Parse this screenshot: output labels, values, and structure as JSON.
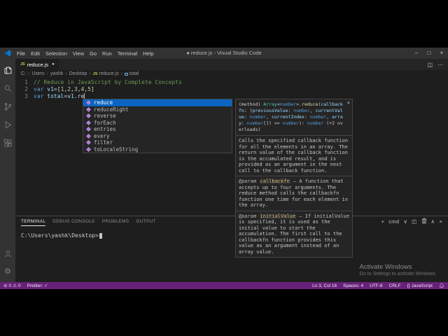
{
  "colors": {
    "statusbar_background": "#68217a",
    "suggest_selection_background": "#0a65c2",
    "editor_background": "#1e1e1e",
    "activitybar_background": "#333333",
    "panel_background": "#252526",
    "comment_green": "#6a9955",
    "keyword_blue": "#569cd6",
    "variable_blue": "#9cdcfe",
    "number_green": "#b5cea8"
  },
  "icons": {
    "js_badge": "JS",
    "minimize": "–",
    "maximize": "□",
    "close": "×",
    "ellipsis": "⋯",
    "split_editor": "◫",
    "dirty_dot": "●",
    "chevron_down": "∨",
    "chevron_up": "∧",
    "plus": "+",
    "error": "⊘",
    "warning": "⚠"
  },
  "titlebar": {
    "menus": [
      "File",
      "Edit",
      "Selection",
      "View",
      "Go",
      "Run",
      "Terminal",
      "Help"
    ],
    "title": "● reduce.js - Visual Studio Code"
  },
  "activitybar": {
    "top": [
      "explorer",
      "search",
      "source-control",
      "run-and-debug",
      "extensions"
    ],
    "bottom": [
      "account",
      "settings"
    ]
  },
  "tabbar": {
    "tab": {
      "label": "reduce.js"
    }
  },
  "breadcrumb": {
    "separator": "›",
    "items": [
      {
        "label": "C:"
      },
      {
        "label": "Users"
      },
      {
        "label": "yashk"
      },
      {
        "label": "Desktop"
      },
      {
        "label": "reduce.js",
        "icon": "js-badge"
      },
      {
        "label": "total",
        "icon": "symbol"
      }
    ]
  },
  "editor": {
    "cursor_line": "3",
    "lines": [
      {
        "num": "1",
        "segments": [
          {
            "t": "// Reduce in JavaScript by Complete Concepts",
            "c": "comment"
          }
        ]
      },
      {
        "num": "2",
        "segments": [
          {
            "t": "var ",
            "c": "keyword"
          },
          {
            "t": "v1",
            "c": "variable"
          },
          {
            "t": "=",
            "c": "plain"
          },
          {
            "t": "[",
            "c": "plain"
          },
          {
            "t": "1",
            "c": "number"
          },
          {
            "t": ",",
            "c": "plain"
          },
          {
            "t": "2",
            "c": "number"
          },
          {
            "t": ",",
            "c": "plain"
          },
          {
            "t": "3",
            "c": "number"
          },
          {
            "t": ",",
            "c": "plain"
          },
          {
            "t": "4",
            "c": "number"
          },
          {
            "t": ",",
            "c": "plain"
          },
          {
            "t": "5",
            "c": "number"
          },
          {
            "t": "]",
            "c": "plain"
          }
        ]
      },
      {
        "num": "3",
        "segments": [
          {
            "t": "var ",
            "c": "keyword"
          },
          {
            "t": "total",
            "c": "variable"
          },
          {
            "t": "=",
            "c": "plain"
          },
          {
            "t": "v1",
            "c": "variable"
          },
          {
            "t": ".re",
            "c": "plain"
          }
        ]
      }
    ]
  },
  "suggest": {
    "items": [
      {
        "label": "reduce",
        "selected": true
      },
      {
        "label": "reduceRight"
      },
      {
        "label": "reverse"
      },
      {
        "label": "forEach"
      },
      {
        "label": "entries"
      },
      {
        "label": "every"
      },
      {
        "label": "filter"
      },
      {
        "label": "toLocaleString"
      }
    ]
  },
  "docs": {
    "signature_segments": [
      {
        "t": "(method) ",
        "c": "plain"
      },
      {
        "t": "Array",
        "c": "type"
      },
      {
        "t": "<",
        "c": "plain"
      },
      {
        "t": "number",
        "c": "kw"
      },
      {
        "t": ">.",
        "c": "plain"
      },
      {
        "t": "reduce",
        "c": "fn"
      },
      {
        "t": "(",
        "c": "plain"
      },
      {
        "t": "callbackfn",
        "c": "param"
      },
      {
        "t": ": (",
        "c": "plain"
      },
      {
        "t": "previousValue",
        "c": "param"
      },
      {
        "t": ": ",
        "c": "plain"
      },
      {
        "t": "number",
        "c": "kw"
      },
      {
        "t": ", ",
        "c": "plain"
      },
      {
        "t": "currentValue",
        "c": "param"
      },
      {
        "t": ": ",
        "c": "plain"
      },
      {
        "t": "number",
        "c": "kw"
      },
      {
        "t": ", ",
        "c": "plain"
      },
      {
        "t": "currentIndex",
        "c": "param"
      },
      {
        "t": ": ",
        "c": "plain"
      },
      {
        "t": "number",
        "c": "kw"
      },
      {
        "t": ", ",
        "c": "plain"
      },
      {
        "t": "array",
        "c": "param"
      },
      {
        "t": ": ",
        "c": "plain"
      },
      {
        "t": "number",
        "c": "kw"
      },
      {
        "t": "[]) => ",
        "c": "plain"
      },
      {
        "t": "number",
        "c": "kw"
      },
      {
        "t": "): ",
        "c": "plain"
      },
      {
        "t": "number",
        "c": "kw"
      },
      {
        "t": " (+2 overloads)",
        "c": "plain"
      }
    ],
    "description": "Calls the specified callback function for all the elements in an array. The return value of the callback function is the accumulated result, and is provided as an argument in the next call to the callback function.",
    "params": [
      {
        "tag": "@param",
        "name": "callbackfn",
        "text": "— A function that accepts up to four arguments. The reduce method calls the callbackfn function one time for each element in the array."
      },
      {
        "tag": "@param",
        "name": "initialValue",
        "text": "— If initialValue is specified, it is used as the initial value to start the accumulation. The first call to the callbackfn function provides this value as an argument instead of an array value."
      }
    ]
  },
  "terminal": {
    "tabs": [
      {
        "label": "TERMINAL",
        "active": true
      },
      {
        "label": "DEBUG CONSOLE"
      },
      {
        "label": "PROBLEMS"
      },
      {
        "label": "OUTPUT"
      }
    ],
    "shell": "cmd",
    "prompt": "C:\\Users\\yashk\\Desktop>"
  },
  "watermark": {
    "line1": "Activate Windows",
    "line2": "Go to Settings to activate Windows."
  },
  "statusbar": {
    "left": [
      {
        "type": "problems",
        "errors": "0",
        "warnings": "0"
      },
      {
        "type": "text",
        "name": "prettier",
        "label": "Prettier: ✓"
      }
    ],
    "right": [
      {
        "name": "line-col",
        "label": "Ln 3, Col 16"
      },
      {
        "name": "indentation",
        "label": "Spaces: 4"
      },
      {
        "name": "encoding",
        "label": "UTF-8"
      },
      {
        "name": "eol",
        "label": "CRLF"
      },
      {
        "name": "language",
        "label": "{} JavaScript"
      }
    ]
  }
}
